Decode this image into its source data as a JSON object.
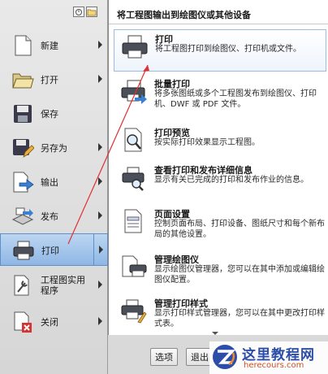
{
  "menu": {
    "items": [
      {
        "label": "新建",
        "has_submenu": true,
        "icon": "new-document-icon"
      },
      {
        "label": "打开",
        "has_submenu": true,
        "icon": "open-folder-icon"
      },
      {
        "label": "保存",
        "has_submenu": false,
        "icon": "save-icon"
      },
      {
        "label": "另存为",
        "has_submenu": true,
        "icon": "save-as-icon"
      },
      {
        "label": "输出",
        "has_submenu": true,
        "icon": "export-icon"
      },
      {
        "label": "发布",
        "has_submenu": true,
        "icon": "publish-icon"
      },
      {
        "label": "打印",
        "has_submenu": true,
        "icon": "print-icon",
        "selected": true
      },
      {
        "label": "工程图实用",
        "label2": "程序",
        "has_submenu": true,
        "icon": "wrench-icon"
      },
      {
        "label": "关闭",
        "has_submenu": true,
        "icon": "close-document-icon"
      }
    ]
  },
  "panel": {
    "header": "将工程图输出到绘图仪或其他设备",
    "entries": [
      {
        "title": "打印",
        "desc": "将工程图打印到绘图仪、打印机或文件。",
        "icon": "printer-icon"
      },
      {
        "title": "批量打印",
        "desc": "将多张图纸或多个工程图发布到绘图仪、打印机、DWF 或 PDF 文件。",
        "icon": "batch-plot-icon"
      },
      {
        "title": "打印预览",
        "desc": "按实际打印效果显示工程图。",
        "icon": "print-preview-icon"
      },
      {
        "title": "查看打印和发布详细信息",
        "desc": "显示有关已完成的打印和发布作业的信息。",
        "icon": "plot-details-icon"
      },
      {
        "title": "页面设置",
        "desc": "控制页面布局、打印设备、图纸尺寸和每个新布局的其他设置。",
        "icon": "page-setup-icon"
      },
      {
        "title": "管理绘图仪",
        "desc": "显示绘图仪管理器，您可以在其中添加或编辑绘图仪配置。",
        "icon": "plotter-manager-icon"
      },
      {
        "title": "管理打印样式",
        "desc": "显示打印样式管理器，您可以在其中更改打印样式表。",
        "icon": "plot-style-icon"
      }
    ]
  },
  "bottom": {
    "options_label": "选项",
    "exit_label": "退出"
  },
  "watermark": {
    "title": "这里教程网",
    "url": "herecours.com"
  },
  "colors": {
    "selection": "#8fb7e4",
    "annotation_arrow": "#e03030",
    "watermark_blue": "#2c4da8"
  }
}
